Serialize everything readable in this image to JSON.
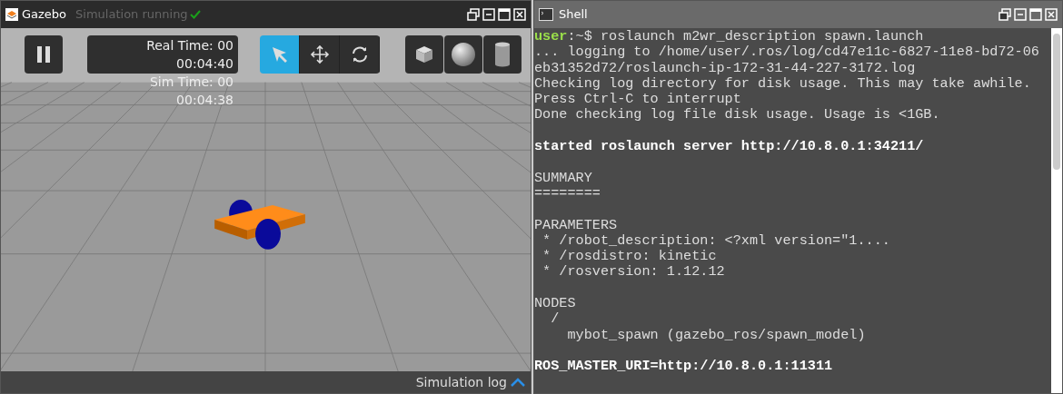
{
  "gazebo": {
    "title": "Gazebo",
    "status": "Simulation running",
    "real_time_label": "Real Time: 00",
    "real_time": "00:04:40",
    "sim_time_label": "Sim Time: 00",
    "sim_time": "00:04:38",
    "tools": [
      {
        "kind": "select",
        "selected": true
      },
      {
        "kind": "translate",
        "selected": false
      },
      {
        "kind": "rotate",
        "selected": false
      }
    ],
    "shapes": [
      {
        "kind": "box"
      },
      {
        "kind": "sphere"
      },
      {
        "kind": "cylinder"
      }
    ],
    "log_label": "Simulation log"
  },
  "shell": {
    "title": "Shell",
    "lines": [
      {
        "kind": "prompt",
        "user": "user",
        "text": ":~$ roslaunch m2wr_description spawn.launch"
      },
      {
        "kind": "text",
        "text": "... logging to /home/user/.ros/log/cd47e11c-6827-11e8-bd72-06"
      },
      {
        "kind": "text",
        "text": "eb31352d72/roslaunch-ip-172-31-44-227-3172.log"
      },
      {
        "kind": "text",
        "text": "Checking log directory for disk usage. This may take awhile."
      },
      {
        "kind": "text",
        "text": "Press Ctrl-C to interrupt"
      },
      {
        "kind": "text",
        "text": "Done checking log file disk usage. Usage is <1GB."
      },
      {
        "kind": "blank"
      },
      {
        "kind": "bold",
        "text": "started roslaunch server http://10.8.0.1:34211/"
      },
      {
        "kind": "blank"
      },
      {
        "kind": "text",
        "text": "SUMMARY"
      },
      {
        "kind": "text",
        "text": "========"
      },
      {
        "kind": "blank"
      },
      {
        "kind": "text",
        "text": "PARAMETERS"
      },
      {
        "kind": "text",
        "text": " * /robot_description: <?xml version=\"1...."
      },
      {
        "kind": "text",
        "text": " * /rosdistro: kinetic"
      },
      {
        "kind": "text",
        "text": " * /rosversion: 1.12.12"
      },
      {
        "kind": "blank"
      },
      {
        "kind": "text",
        "text": "NODES"
      },
      {
        "kind": "text",
        "text": "  /"
      },
      {
        "kind": "text",
        "text": "    mybot_spawn (gazebo_ros/spawn_model)"
      },
      {
        "kind": "blank"
      },
      {
        "kind": "bold",
        "text": "ROS_MASTER_URI=http://10.8.0.1:11311"
      }
    ]
  }
}
